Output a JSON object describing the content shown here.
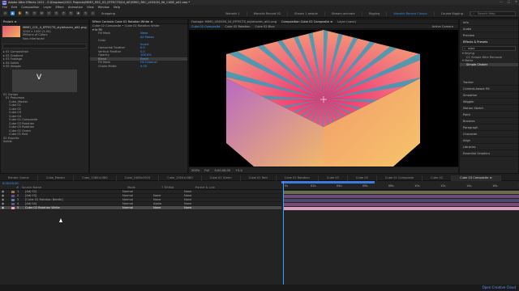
{
  "window": {
    "title": "Adobe After Effects 2021 - E:\\Dropbox\\2021 Projects\\MIMO_REC_05_EFFECTS\\04_AE\\MIMO_REC_LESSON_06_CUBE_a02.aep *",
    "controls": [
      "—",
      "□",
      "✕"
    ]
  },
  "menu": [
    "File",
    "Edit",
    "Composition",
    "Layer",
    "Effect",
    "Animation",
    "View",
    "Window",
    "Help"
  ],
  "toolbar": {
    "tools": [
      "⌂",
      "▲",
      "✋",
      "🔍",
      "↻",
      "⊕",
      "▭",
      "✎",
      "T",
      "✒",
      "◆",
      "✦",
      "⌖"
    ],
    "snapping": "Snapping"
  },
  "workspaces": [
    "Wanakk 1",
    "Wanakk Record 02",
    "Shown 1 people",
    "Stream animate",
    "Rigging",
    "Wanakk Record Classic",
    "Course Rigging"
  ],
  "search_help": "Search Help",
  "project": {
    "header": [
      "Project ≡",
      "Effect Controls Cube 02 Rotation White ≡"
    ],
    "file_name": "MIMO_C01_4_EFFECTS_stylehaven_alt1.png",
    "file_info": "2000 x 1500 (1.00)",
    "file_colors": "Millions of Colors",
    "file_interp": "Non-Interlaced",
    "items": [
      "01 Composition",
      "02 Gradient",
      "03 Footage",
      "04 Solids",
      "05 Images",
      "Cube_Master",
      "Cube 01",
      "Cube 02",
      "Cube 03",
      "Cube 04",
      "Cube 01 Composite",
      "Cube 02 Rotation",
      "Cube 03 Rotation",
      "Cube 01 Green",
      "Cube 01 Red",
      "06 Exports",
      "Solids"
    ],
    "section_labels": [
      "01 Comps",
      "01 Precomps",
      "02 Exports"
    ]
  },
  "effect_controls": {
    "layer": "Cube 02 Composite • Cube 02 Rotation White",
    "fx": "Fill",
    "rows": [
      {
        "label": "Fill Mask",
        "value": "None"
      },
      {
        "label": "",
        "value": "All Masks"
      },
      {
        "label": "Color",
        "value": ""
      },
      {
        "label": "",
        "value": "Invert"
      },
      {
        "label": "Horizontal Feather",
        "value": "0.0"
      },
      {
        "label": "Vertical Feather",
        "value": "0.0"
      },
      {
        "label": "Opacity",
        "value": "100.0%"
      },
      {
        "label": "Blend",
        "value": "Reset"
      },
      {
        "label": "Fill Mask",
        "value": "Fill Channel"
      },
      {
        "label": "Choke Matte",
        "value": "0.00"
      }
    ]
  },
  "composition": {
    "tabs": [
      "Footage: MIMO_LESSON_04_EFFECTS_stylehaven_alt1.png",
      "Composition Cube 02 Composite ≡",
      "Layer (none)"
    ],
    "subtabs": [
      "Cube 02 Composite",
      "Cube 02 Rotation",
      "Cube 02 Blue"
    ],
    "active_camera": "Active Camera",
    "footer": {
      "zoom": "200%",
      "resolution": "Full",
      "time": "0;00;00;00",
      "frame": "+0.0"
    },
    "colors": {
      "c1": "#3a9bb8",
      "c2": "#f24c72",
      "c3": "#f3b25b",
      "c4": "#8a6aca"
    }
  },
  "right_panel": {
    "items": [
      "Info",
      "Audio",
      "Preview",
      "Effects & Presets",
      "Align",
      "Tracker",
      "Content-Aware Fill",
      "Smoother",
      "Wiggler",
      "Motion Sketch",
      "Paint",
      "Brushes",
      "Paragraph",
      "Character",
      "Align",
      "Libraries",
      "Essential Graphics"
    ],
    "effects_search": "wipe",
    "effects_group": "Keying",
    "effects_group2": "Matte",
    "effects_items": [
      "CC Simple Wire Removal",
      "Simple Choker"
    ]
  },
  "timeline": {
    "tabs": [
      "Render Queue",
      "Cube_Master",
      "Cube_1080x1080",
      "Cube_1080x1920",
      "Cube_1920x1080",
      "Cube 01 Green",
      "Cube 01 Red",
      "Cube 02 Rotation",
      "Cube 03",
      "Cube 04",
      "Cube 01 Composite",
      "Cube 02",
      "Cube 03 Composite ≡"
    ],
    "timecode": "0;00;00;00",
    "columns": [
      "#",
      "Source Name",
      "Mode",
      "T TrkMat",
      "Parent & Link"
    ],
    "layers": [
      {
        "n": "1",
        "name": "[Adj 02]",
        "mode": "Normal",
        "trk": "",
        "parent": "None",
        "color": "#8d7a40"
      },
      {
        "n": "2",
        "name": "[Adj 03]",
        "mode": "Normal",
        "trk": "None",
        "parent": "None",
        "color": "#6a4a8a"
      },
      {
        "n": "3",
        "name": "[Cube 02 Rotation Beetle]",
        "mode": "Normal",
        "trk": "None",
        "parent": "None",
        "color": "#5c7ea3"
      },
      {
        "n": "4",
        "name": "[Adj 04]",
        "mode": "Normal",
        "trk": "Alpha",
        "parent": "None",
        "color": "#7a4a7a"
      },
      {
        "n": "5",
        "name": "Cube 02 Rotation White",
        "mode": "Normal",
        "trk": "None",
        "parent": "None",
        "color": "#e3a8c8"
      }
    ],
    "ruler": [
      "0s",
      "02s",
      "04s",
      "06s",
      "08s",
      "10s",
      "12s",
      "14s",
      "16s",
      "18s"
    ],
    "bar_colors": [
      "#6c6c4e",
      "#6c4a7a",
      "#4a4a6c",
      "#7a4a7a",
      "#d8a2be"
    ]
  },
  "creative_cloud": "Open Creative Cloud"
}
